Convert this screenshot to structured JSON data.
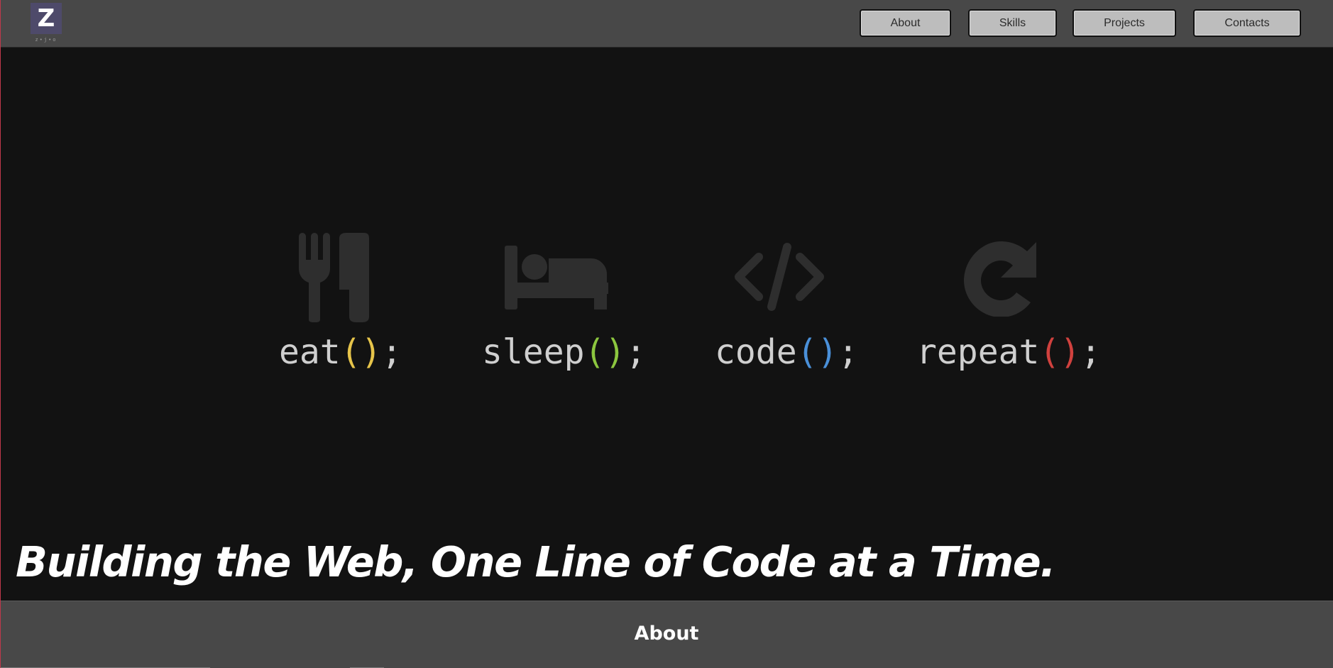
{
  "header": {
    "logo_letter": "Z",
    "logo_subtext": "z•j•o",
    "nav": {
      "about": "About",
      "skills": "Skills",
      "projects": "Projects",
      "contacts": "Contacts"
    }
  },
  "hero": {
    "activities": [
      {
        "icon": "utensils-icon",
        "name": "eat",
        "paren_color": "#e6c44a"
      },
      {
        "icon": "bed-icon",
        "name": "sleep",
        "paren_color": "#8cc63f"
      },
      {
        "icon": "code-icon",
        "name": "code",
        "paren_color": "#4a90d9"
      },
      {
        "icon": "redo-icon",
        "name": "repeat",
        "paren_color": "#d0413e"
      }
    ],
    "call_suffix_open": "(",
    "call_suffix_close": ")",
    "terminator": ";",
    "tagline": "Building the Web, One Line of Code at a Time."
  },
  "about_section": {
    "title": "About"
  },
  "colors": {
    "nav_background": "#484848",
    "page_background": "#121212",
    "icon_color": "#2e2e2e",
    "button_background": "#bdbdbd",
    "logo_background": "#4e4a6a"
  }
}
